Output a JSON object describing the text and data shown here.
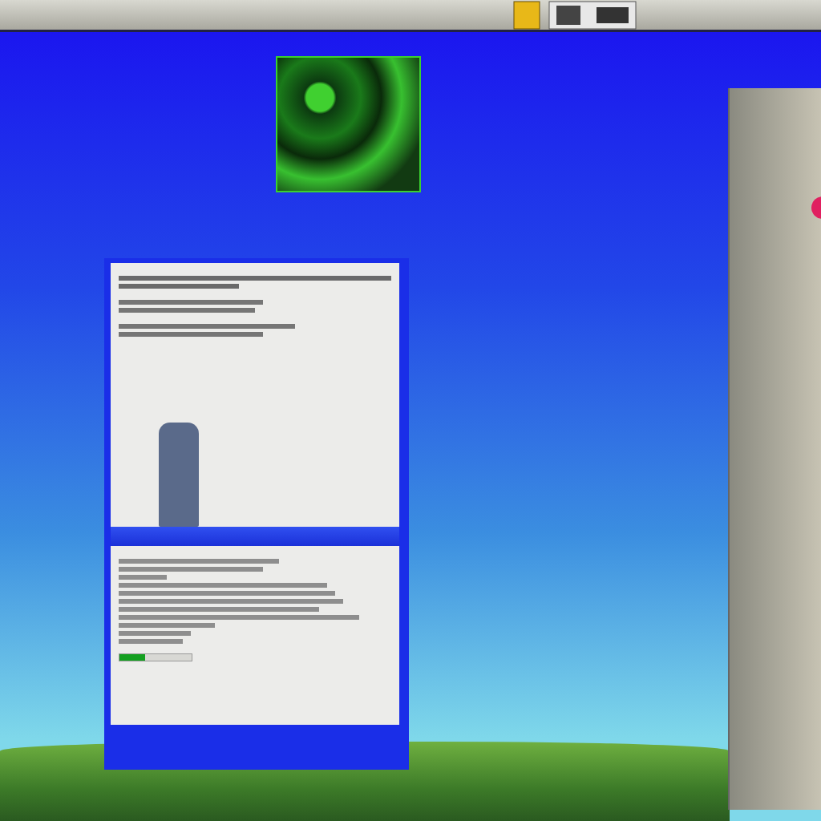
{
  "window": {
    "progress": {
      "level": 0.35
    }
  }
}
